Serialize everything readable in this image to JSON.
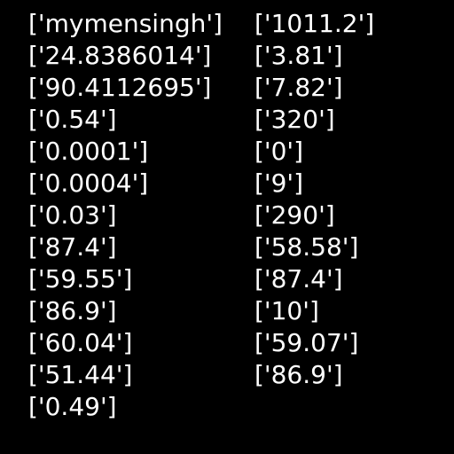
{
  "columns": [
    {
      "items": [
        "['mymensingh']",
        "['24.8386014']",
        "['90.4112695']",
        "['0.54']",
        "['0.0001']",
        "['0.0004']",
        "['0.03']",
        "['87.4']",
        "['59.55']",
        "['86.9']",
        "['60.04']",
        "['51.44']",
        "['0.49']"
      ]
    },
    {
      "items": [
        "['1011.2']",
        "['3.81']",
        "['7.82']",
        "['320']",
        "['0']",
        "['9']",
        "['290']",
        "['58.58']",
        "['87.4']",
        "['10']",
        "['59.07']",
        "['86.9']"
      ]
    }
  ],
  "colors": {
    "background": "#000000",
    "text": "#ffffff"
  }
}
